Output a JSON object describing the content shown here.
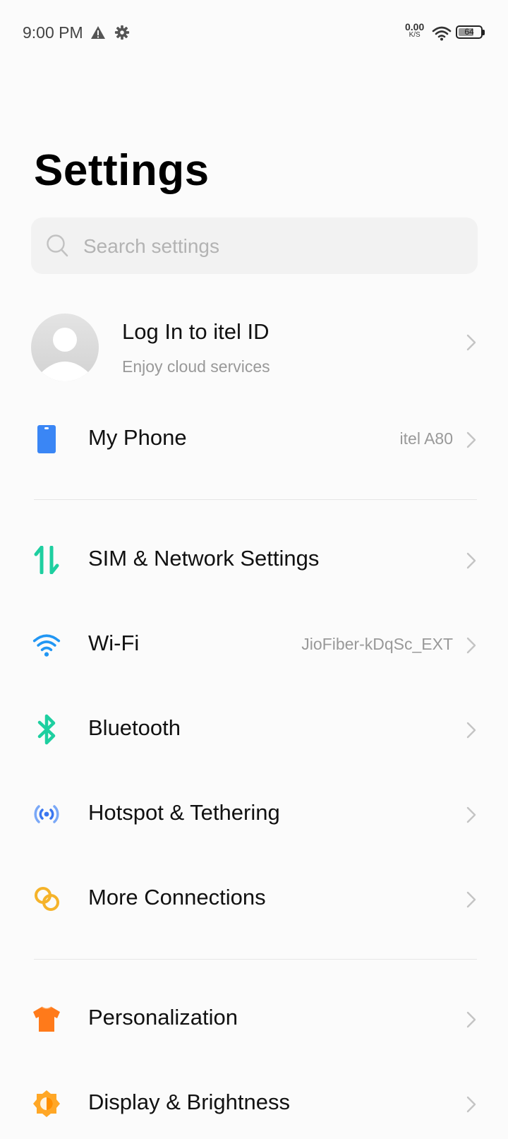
{
  "status_bar": {
    "time": "9:00 PM",
    "net_speed_value": "0.00",
    "net_speed_unit": "K/S",
    "battery_level": "64",
    "icons": [
      "warning-icon",
      "gear-icon",
      "wifi-icon",
      "battery-icon"
    ]
  },
  "page": {
    "title": "Settings"
  },
  "search": {
    "placeholder": "Search settings",
    "value": ""
  },
  "account": {
    "title": "Log In to itel ID",
    "subtitle": "Enjoy cloud services",
    "icon": "avatar-icon"
  },
  "items": [
    {
      "label": "My Phone",
      "value": "itel A80",
      "icon": "phone-icon",
      "color": "#3a86f5"
    },
    {
      "label": "SIM & Network Settings",
      "value": "",
      "icon": "sim-network-icon",
      "color": "#1ecfa0"
    },
    {
      "label": "Wi-Fi",
      "value": "JioFiber-kDqSc_EXT",
      "icon": "wifi-icon",
      "color": "#2196f3"
    },
    {
      "label": "Bluetooth",
      "value": "",
      "icon": "bluetooth-icon",
      "color": "#1ecfa0"
    },
    {
      "label": "Hotspot & Tethering",
      "value": "",
      "icon": "hotspot-icon",
      "color": "#5a8df5"
    },
    {
      "label": "More Connections",
      "value": "",
      "icon": "connections-icon",
      "color": "#f5b32a"
    },
    {
      "label": "Personalization",
      "value": "",
      "icon": "shirt-icon",
      "color": "#ff7a1a"
    },
    {
      "label": "Display & Brightness",
      "value": "",
      "icon": "brightness-icon",
      "color": "#ffa726"
    }
  ],
  "colors": {
    "background": "#fbfbfb",
    "search_bg": "#f2f2f2",
    "secondary_text": "#999999",
    "chevron": "#c4c4c4"
  }
}
